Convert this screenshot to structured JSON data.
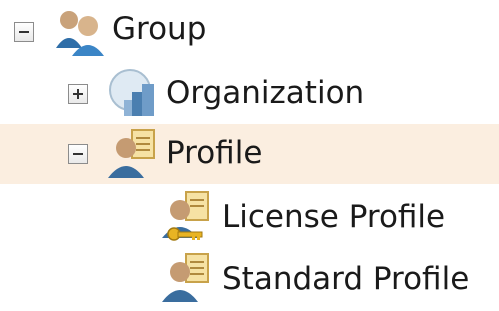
{
  "tree": {
    "items": [
      {
        "label": "Group",
        "expanded": true,
        "icon": "group-icon"
      },
      {
        "label": "Organization",
        "expanded": false,
        "icon": "organization-icon"
      },
      {
        "label": "Profile",
        "expanded": true,
        "selected": true,
        "icon": "profile-icon"
      },
      {
        "label": "License Profile",
        "icon": "license-profile-icon"
      },
      {
        "label": "Standard Profile",
        "icon": "standard-profile-icon"
      }
    ]
  },
  "colors": {
    "selection_background": "#fbeee0",
    "label_text": "#1a1a1a"
  }
}
